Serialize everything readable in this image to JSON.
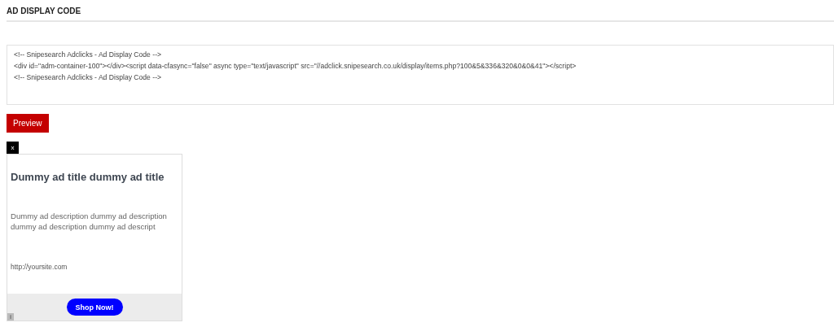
{
  "section_title": "AD DISPLAY CODE",
  "code_lines": [
    "<!-- Snipesearch Adclicks - Ad Display Code -->",
    "<div id=\"adm-container-100\"></div><script data-cfasync=\"false\" async type=\"text/javascript\" src=\"//adclick.snipesearch.co.uk/display/items.php?100&5&336&320&0&0&41\"></script>",
    "<!-- Snipesearch Adclicks - Ad Display Code -->"
  ],
  "preview_button": "Preview",
  "ad": {
    "close": "x",
    "title": "Dummy ad title dummy ad title",
    "description": "Dummy ad description dummy ad description dummy ad description dummy ad descript",
    "url": "http://yoursite.com",
    "cta": "Shop Now!",
    "info": "i"
  }
}
